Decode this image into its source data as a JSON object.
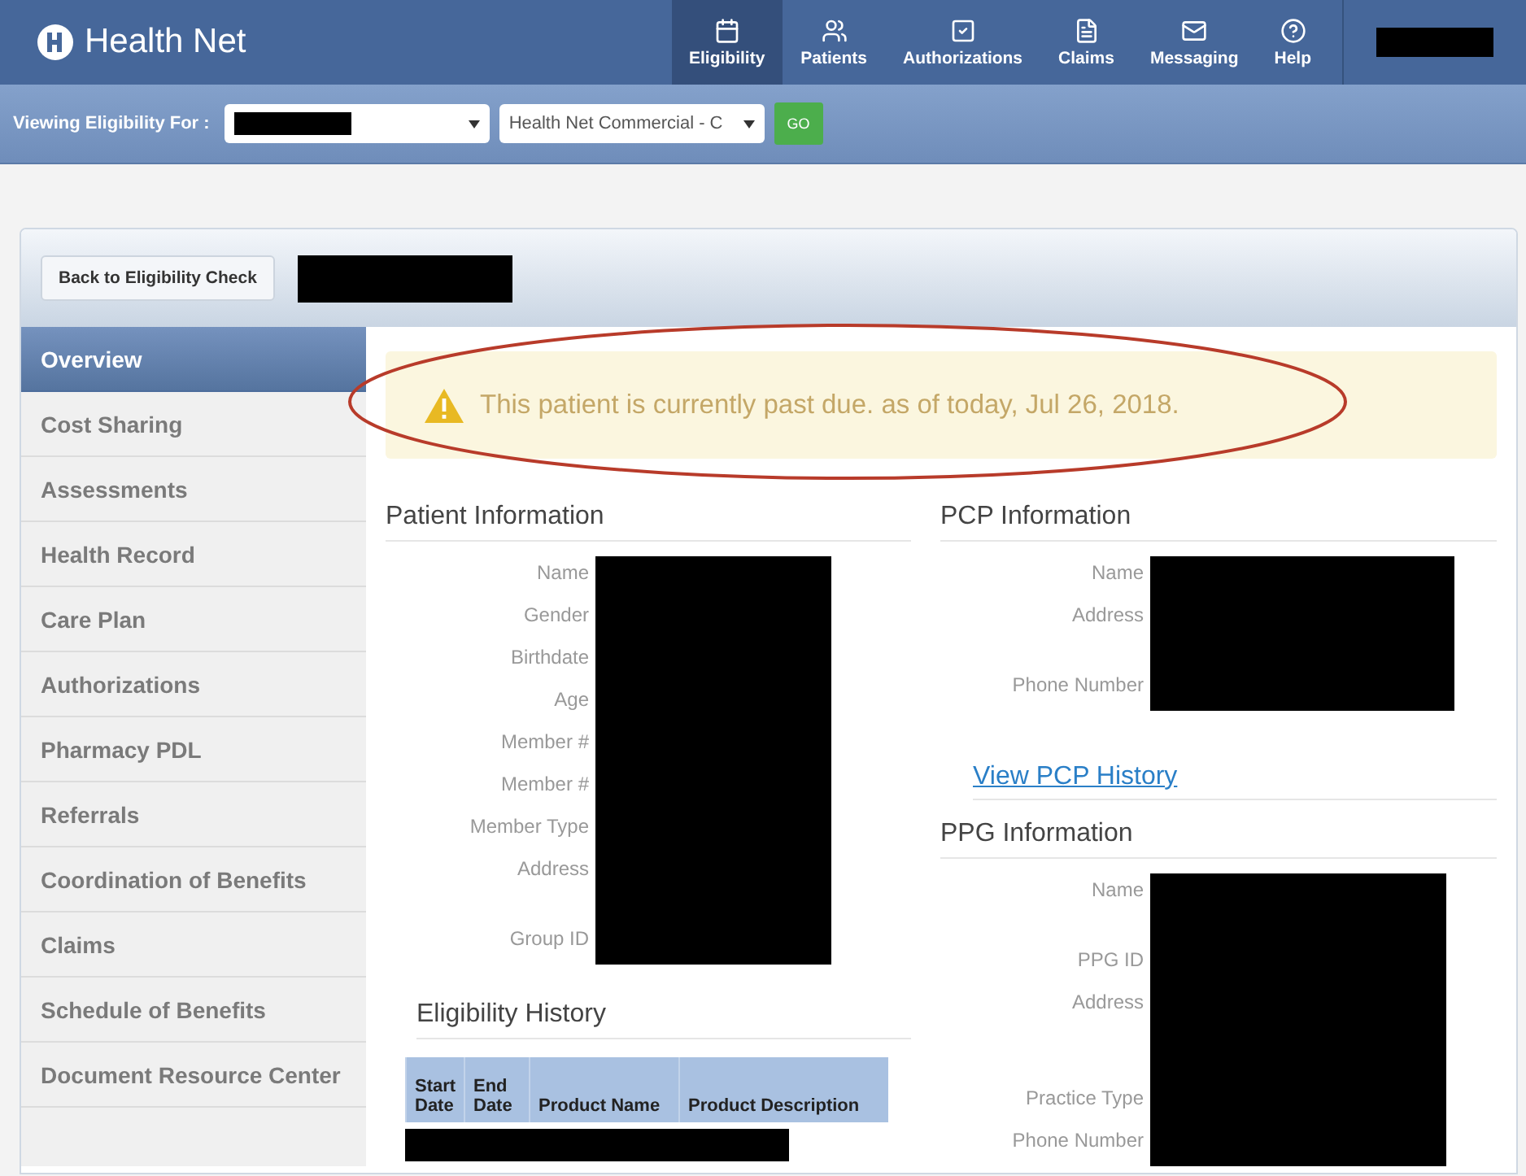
{
  "header": {
    "logo": "Health Net",
    "nav": [
      {
        "label": "Eligibility",
        "selected": true
      },
      {
        "label": "Patients",
        "selected": false
      },
      {
        "label": "Authorizations",
        "selected": false
      },
      {
        "label": "Claims",
        "selected": false
      },
      {
        "label": "Messaging",
        "selected": false
      },
      {
        "label": "Help",
        "selected": false
      }
    ]
  },
  "filter_bar": {
    "label": "Viewing Eligibility For :",
    "plan_select": "Health Net Commercial - C",
    "go_button": "GO"
  },
  "back_button": "Back to Eligibility Check",
  "sidebar": {
    "items": [
      {
        "label": "Overview",
        "selected": true
      },
      {
        "label": "Cost Sharing",
        "selected": false
      },
      {
        "label": "Assessments",
        "selected": false
      },
      {
        "label": "Health Record",
        "selected": false
      },
      {
        "label": "Care Plan",
        "selected": false
      },
      {
        "label": "Authorizations",
        "selected": false
      },
      {
        "label": "Pharmacy PDL",
        "selected": false
      },
      {
        "label": "Referrals",
        "selected": false
      },
      {
        "label": "Coordination of Benefits",
        "selected": false
      },
      {
        "label": "Claims",
        "selected": false
      },
      {
        "label": "Schedule of Benefits",
        "selected": false
      },
      {
        "label": "Document Resource Center",
        "selected": false
      }
    ]
  },
  "alert": "This patient is currently past due. as of today, Jul 26, 2018.",
  "patient_information": {
    "title": "Patient Information",
    "fields": [
      {
        "label": "Name",
        "kind": "line"
      },
      {
        "label": "Gender",
        "kind": "line"
      },
      {
        "label": "Birthdate",
        "kind": "line"
      },
      {
        "label": "Age",
        "kind": "line"
      },
      {
        "label": "Member #",
        "kind": "line"
      },
      {
        "label": "Member #",
        "kind": "line"
      },
      {
        "label": "Member Type",
        "kind": "line"
      },
      {
        "label": "Address",
        "kind": "block"
      },
      {
        "label": "Group ID",
        "kind": "line"
      }
    ]
  },
  "eligibility_history": {
    "title": "Eligibility History",
    "columns": [
      "Start Date",
      "End Date",
      "Product Name",
      "Product Description"
    ]
  },
  "pcp_information": {
    "title": "PCP Information",
    "fields": [
      {
        "label": "Name",
        "kind": "line"
      },
      {
        "label": "Address",
        "kind": "block"
      },
      {
        "label": "Phone Number",
        "kind": "line"
      }
    ],
    "link": "View PCP History"
  },
  "ppg_information": {
    "title": "PPG Information",
    "fields": [
      {
        "label": "Name",
        "kind": "block"
      },
      {
        "label": "PPG ID",
        "kind": "line"
      },
      {
        "label": "Address",
        "kind": "large"
      },
      {
        "label": "Practice Type",
        "kind": "line"
      },
      {
        "label": "Phone Number",
        "kind": "line"
      }
    ]
  }
}
